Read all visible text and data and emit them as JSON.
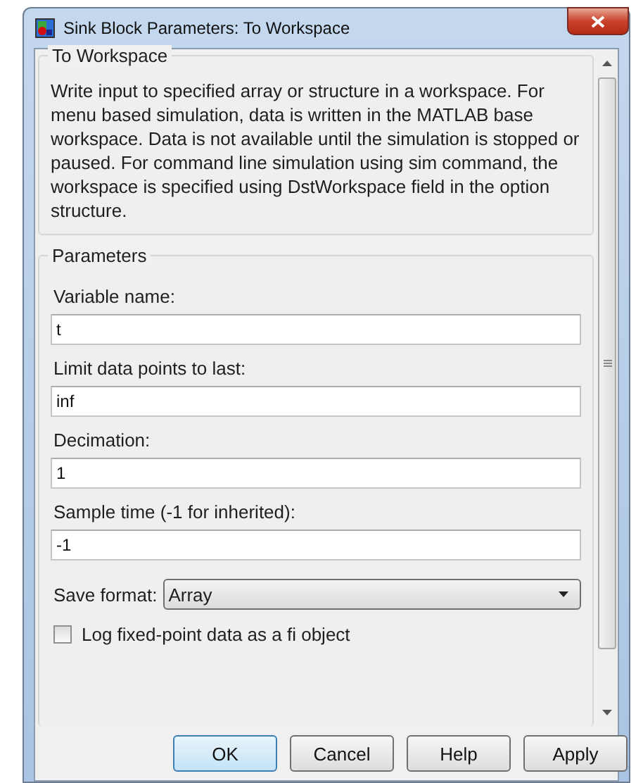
{
  "window": {
    "title": "Sink Block Parameters: To Workspace"
  },
  "description_group": {
    "title": "To Workspace",
    "text": "Write input to specified array or structure in a workspace. For menu based simulation, data is written in the MATLAB base workspace. Data is not available until the simulation is stopped or paused. For command line simulation using sim command, the workspace is specified using DstWorkspace field in the option structure."
  },
  "parameters_group": {
    "title": "Parameters",
    "fields": [
      {
        "label": "Variable name:",
        "value": "t"
      },
      {
        "label": "Limit data points to last:",
        "value": "inf"
      },
      {
        "label": "Decimation:",
        "value": "1"
      },
      {
        "label": "Sample time (-1 for inherited):",
        "value": "-1"
      }
    ],
    "save_format": {
      "label": "Save format:",
      "value": "Array"
    },
    "checkbox": {
      "label": "Log fixed-point data as a fi object",
      "checked": false
    }
  },
  "buttons": [
    {
      "label": "OK",
      "default": true
    },
    {
      "label": "Cancel",
      "default": false
    },
    {
      "label": "Help",
      "default": false
    },
    {
      "label": "Apply",
      "default": false
    }
  ]
}
